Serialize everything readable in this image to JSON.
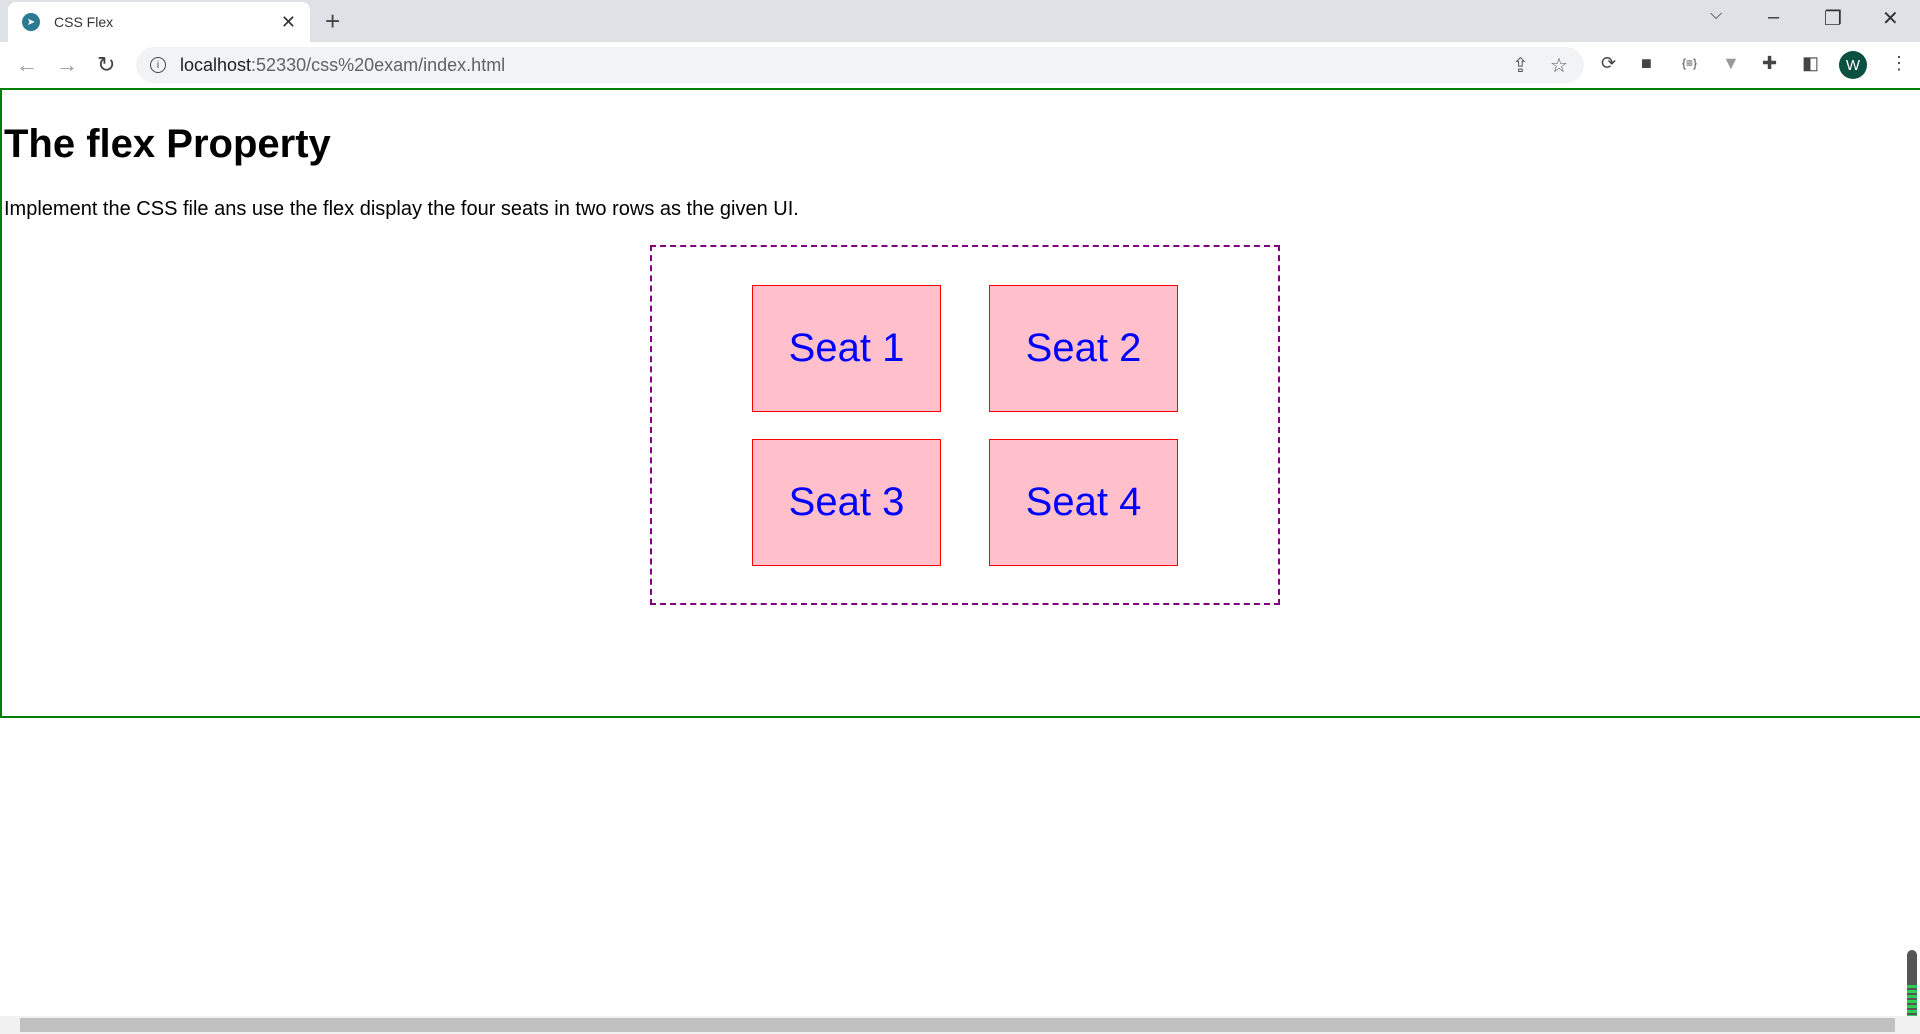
{
  "browser": {
    "tab_title": "CSS Flex",
    "url_host": "localhost",
    "url_rest": ":52330/css%20exam/index.html",
    "profile_initial": "W"
  },
  "page": {
    "heading": "The flex Property",
    "description": "Implement the CSS file ans use the flex display the four seats in two rows as the given UI.",
    "seats": [
      "Seat 1",
      "Seat 2",
      "Seat 3",
      "Seat 4"
    ]
  },
  "colors": {
    "seat_bg": "#ffc0cb",
    "seat_border": "#ff0000",
    "seat_text": "#0000ff",
    "container_border": "#800080",
    "page_border": "#008000"
  }
}
